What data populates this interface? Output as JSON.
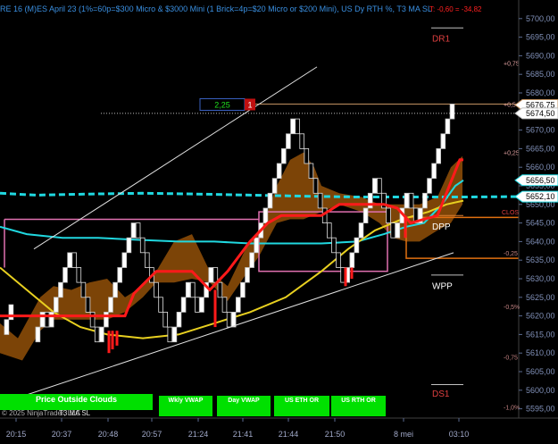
{
  "title": "RE 16 (M)ES April 23 (1%=60p=$300 Micro & $3000 Mini  (1 Brick=4p=$20 Micro or $200 Mini), US Dy RTH %, T3 MA SL",
  "pnl_text": "T: -0,60 = -34,82",
  "colors": {
    "background": "#000000",
    "up_brick": "#ffffff",
    "down_brick": "#000000",
    "stop_line": "#ff1a1a",
    "cloud": "#8a4b08",
    "ma_cyan": "#20d8e0",
    "ma_yellow": "#e8d020",
    "vwap_pink": "#e070b0",
    "orange_level": "#e07010",
    "button_green": "#00e000"
  },
  "chart_data": {
    "type": "renko",
    "brick_size_points": 4,
    "ylim": [
      5592.5,
      5705
    ],
    "y_ticks": [
      5595,
      5600,
      5605,
      5610,
      5615,
      5620,
      5625,
      5630,
      5635,
      5640,
      5645,
      5650,
      5655,
      5660,
      5665,
      5670,
      5675,
      5680,
      5685,
      5690,
      5695,
      5700
    ],
    "y_tick_labels": [
      "5595,00",
      "5600,00",
      "5605,00",
      "5610,00",
      "5615,00",
      "5620,00",
      "5625,00",
      "5630,00",
      "5635,00",
      "5640,00",
      "5645,00",
      "5650,00",
      "5655,00",
      "5660,00",
      "5665,00",
      "5670,00",
      "5675,00",
      "5680,00",
      "5685,00",
      "5690,00",
      "5695,00",
      "5700,00"
    ],
    "x_tick_labels": [
      "20:15",
      "20:37",
      "20:48",
      "20:57",
      "21:24",
      "21:41",
      "21:44",
      "21:50",
      "8 mei",
      "03:10"
    ],
    "price_markers": [
      {
        "label": "5676,75",
        "value": 5676.75
      },
      {
        "label": "5674,50",
        "value": 5674.5
      },
      {
        "label": "5656,50",
        "value": 5656.5
      },
      {
        "label": "5652,10",
        "value": 5652.1
      }
    ],
    "percent_levels": [
      {
        "label": "+0,75",
        "value": 5688
      },
      {
        "label": "+0,5",
        "value": 5677
      },
      {
        "label": "+0,25",
        "value": 5664
      },
      {
        "label": "CLOS",
        "value": 5648
      },
      {
        "label": "-0,25",
        "value": 5637
      },
      {
        "label": "-0,5%",
        "value": 5622.5
      },
      {
        "label": "-0,75",
        "value": 5609
      },
      {
        "label": "-1,0%",
        "value": 5595.5
      }
    ],
    "pivot_labels": [
      {
        "label": "DR1",
        "value": 5694.5
      },
      {
        "label": "DPP",
        "value": 5644
      },
      {
        "label": "WPP",
        "value": 5628
      },
      {
        "label": "DS1",
        "value": 5599
      }
    ],
    "position_box": {
      "text": "2,25",
      "count": "1",
      "value": 5677
    }
  },
  "buttons": [
    {
      "label": "Price Outside Clouds"
    },
    {
      "label": "Wkly VWAP"
    },
    {
      "label": "Day VWAP"
    },
    {
      "label": "US ETH OR"
    },
    {
      "label": "US RTH OR"
    }
  ],
  "footer": {
    "copyright": "© 2025 NinjaTrader, LLC",
    "indicator": "T3 MA SL"
  }
}
